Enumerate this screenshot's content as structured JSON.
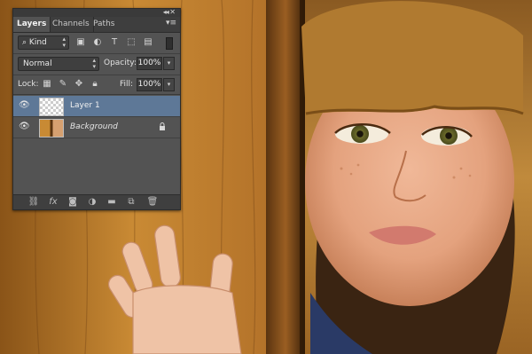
{
  "panel": {
    "tabs": [
      {
        "label": "Layers"
      },
      {
        "label": "Channels"
      },
      {
        "label": "Paths"
      }
    ],
    "filter": {
      "value": "Kind"
    },
    "blend_mode": {
      "value": "Normal"
    },
    "opacity": {
      "label": "Opacity:",
      "value": "100%"
    },
    "lock": {
      "label": "Lock:"
    },
    "fill": {
      "label": "Fill:",
      "value": "100%"
    },
    "layers": [
      {
        "name": "Layer 1",
        "selected": true
      },
      {
        "name": "Background",
        "selected": false,
        "locked": true
      }
    ],
    "bottom_icons": [
      "link-icon",
      "fx-icon",
      "mask-icon",
      "adjustment-icon",
      "folder-icon",
      "new-layer-icon",
      "trash-icon"
    ]
  },
  "colors": {
    "panel_bg": "#535353",
    "selection": "#5e7897",
    "wood": "#c8862e"
  }
}
